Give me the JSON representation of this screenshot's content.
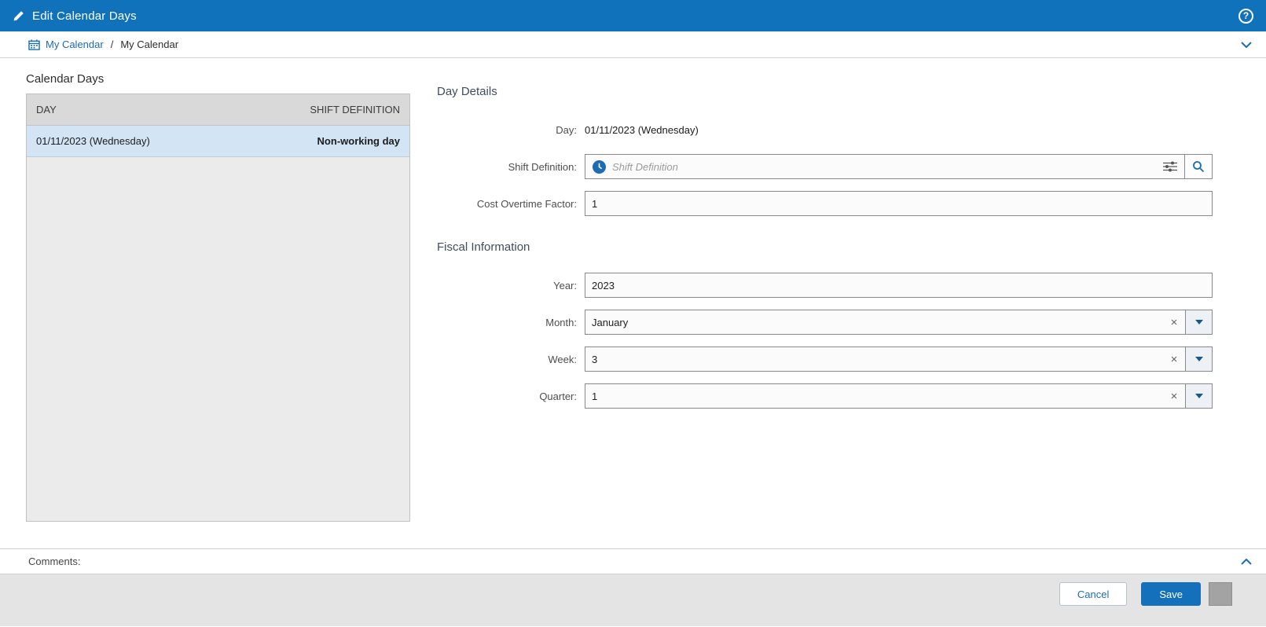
{
  "topbar": {
    "title": "Edit Calendar Days"
  },
  "icons": {
    "help": "?",
    "clear": "×"
  },
  "breadcrumb": {
    "link": "My Calendar",
    "separator": "/",
    "current": "My Calendar"
  },
  "calendar_days": {
    "title": "Calendar Days",
    "columns": {
      "day": "DAY",
      "shift_definition": "SHIFT DEFINITION"
    },
    "rows": [
      {
        "day": "01/11/2023 (Wednesday)",
        "shift_definition": "Non-working day"
      }
    ]
  },
  "day_details": {
    "title": "Day Details",
    "day_label": "Day:",
    "day_value": "01/11/2023 (Wednesday)",
    "shift_definition_label": "Shift Definition:",
    "shift_definition_placeholder": "Shift Definition",
    "cost_overtime_label": "Cost Overtime Factor:",
    "cost_overtime_value": "1"
  },
  "fiscal_information": {
    "title": "Fiscal Information",
    "year_label": "Year:",
    "year_value": "2023",
    "month_label": "Month:",
    "month_value": "January",
    "week_label": "Week:",
    "week_value": "3",
    "quarter_label": "Quarter:",
    "quarter_value": "1"
  },
  "comments": {
    "label": "Comments:"
  },
  "footer": {
    "cancel_label": "Cancel",
    "save_label": "Save"
  },
  "colors": {
    "header_blue": "#1172bc",
    "accent_blue": "#1b6cb3",
    "selected_row": "#d3e4f4",
    "save_button": "#1470bb"
  }
}
